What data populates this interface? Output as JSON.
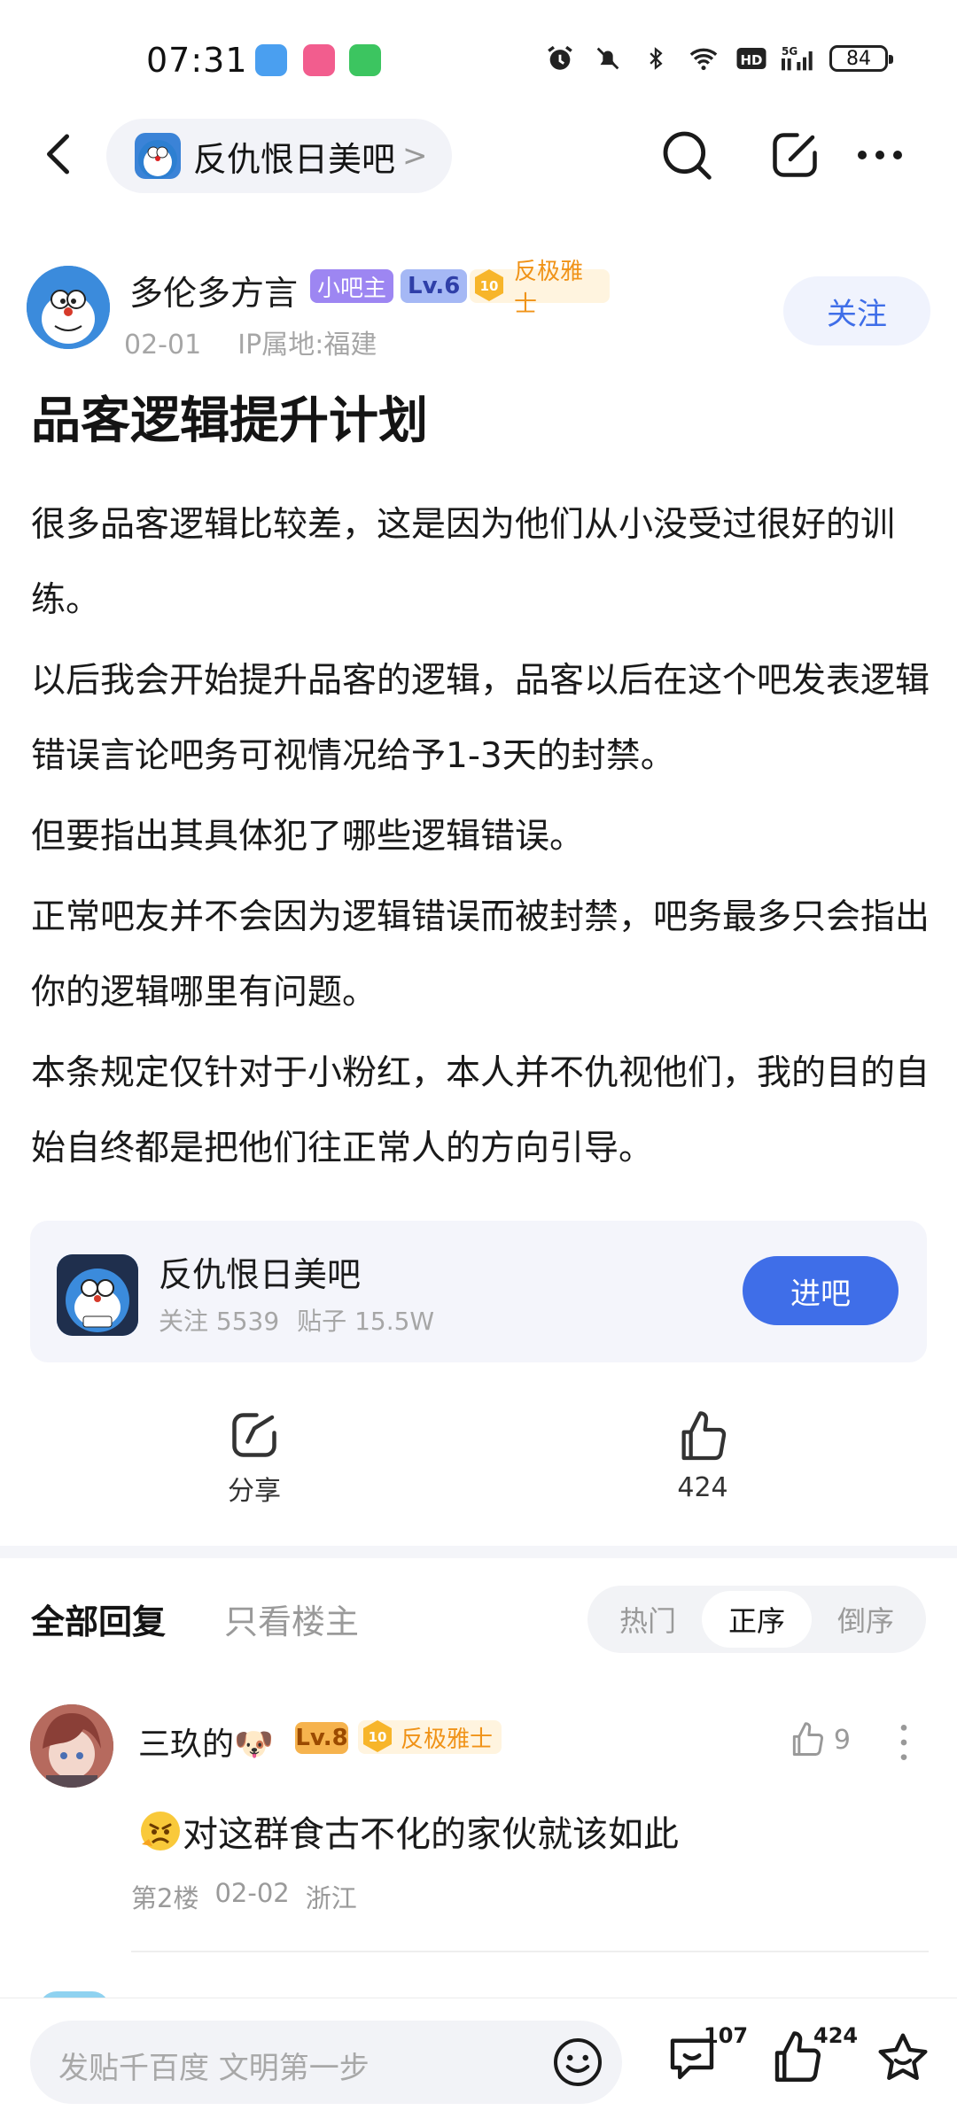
{
  "status_bar": {
    "time": "07:31",
    "battery": "84"
  },
  "nav": {
    "forum_name": "反仇恨日美吧",
    "chevron": ">"
  },
  "author": {
    "name": "多伦多方言",
    "badge_owner": "小吧主",
    "badge_level": "Lv.6",
    "badge_medal_level": "10",
    "badge_title": "反极雅士",
    "date": "02-01",
    "ip_location": "IP属地:福建",
    "follow_label": "关注"
  },
  "post": {
    "title": "品客逻辑提升计划",
    "paragraphs": [
      "很多品客逻辑比较差，这是因为他们从小没受过很好的训练。",
      "以后我会开始提升品客的逻辑，品客以后在这个吧发表逻辑错误言论吧务可视情况给予1-3天的封禁。",
      "但要指出其具体犯了哪些逻辑错误。",
      "正常吧友并不会因为逻辑错误而被封禁，吧务最多只会指出你的逻辑哪里有问题。",
      "本条规定仅针对于小粉红，本人并不仇视他们，我的目的自始自终都是把他们往正常人的方向引导。"
    ]
  },
  "forum_card": {
    "name": "反仇恨日美吧",
    "followers": "关注 5539",
    "posts": "贴子 15.5W",
    "enter_label": "进吧"
  },
  "actions": {
    "share_label": "分享",
    "like_count": "424"
  },
  "reply_tabs": {
    "all_label": "全部回复",
    "op_only_label": "只看楼主",
    "sort_options": [
      "热门",
      "正序",
      "倒序"
    ],
    "active_sort": "正序"
  },
  "comment": {
    "username": "三玖的🐶",
    "level": "Lv.8",
    "medal_level": "10",
    "title": "反极雅士",
    "likes": "9",
    "text": "对这群食古不化的家伙就该如此",
    "floor": "第2楼",
    "date": "02-02",
    "location": "浙江"
  },
  "bottom_bar": {
    "input_placeholder": "发贴千百度 文明第一步",
    "comment_count": "107",
    "like_count": "424"
  },
  "colors": {
    "accent_blue": "#3f6ee8",
    "owner_badge": "#9d86f2",
    "medal_orange": "#f09318"
  }
}
